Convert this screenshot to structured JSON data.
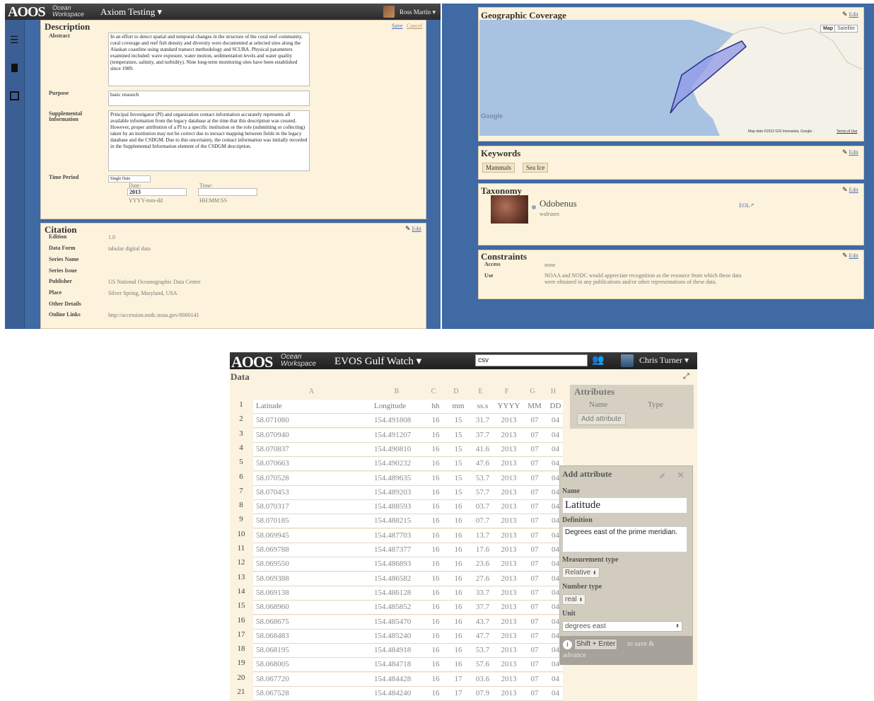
{
  "left_app": {
    "logo": "AOOS",
    "logo_sub1": "Ocean",
    "logo_sub2": "Workspace",
    "project": "Axiom Testing ▾",
    "user": "Ross Martin ▾",
    "description": {
      "title": "Description",
      "save": "Save",
      "cancel": "Cancel",
      "abstract_label": "Abstract",
      "abstract": "In an effort to detect spatial and temporal changes in the structure of the coral reef community, coral coverage and reef fish density and diversity were documented at selected sites along the Alaskan coastline using standard transect methodology and SCUBA. Physical parameters examined included: wave exposure, water motion, sedimentation levels and water quality (temperature, salinity, and turbidity). Nine long-term monitoring sites have been established since 1989.",
      "purpose_label": "Purpose",
      "purpose": "basic research",
      "supp_label1": "Supplemental",
      "supp_label2": "Information",
      "supplemental": "Principal Investigator (PI) and organization contact information accurately represents all available information from the legacy database at the time that this description was created. However, proper attribution of a PI to a specific institution or the role (submitting or collecting) taken by an institution may not be correct due to inexact mapping between fields in the legacy database and the CSDGM. Due to this uncertainty, the contact information was initially recorded in the Supplemental Information element of the CSDGM description.",
      "time_label": "Time Period",
      "time_select": "Single Date",
      "date_label": "Date:",
      "date_value": "2013",
      "date_hint": "YYYY-mm-dd",
      "time_field_label": "Time:",
      "time_hint": "HH:MM:SS"
    },
    "citation": {
      "title": "Citation",
      "edit": "Edit",
      "fields": [
        {
          "label": "Edition",
          "value": "1.0"
        },
        {
          "label": "Data Form",
          "value": "tabular digital data"
        },
        {
          "label": "Series Name",
          "value": ""
        },
        {
          "label": "Series Issue",
          "value": ""
        },
        {
          "label": "Publisher",
          "value": "US National Oceanographic Data Center"
        },
        {
          "label": "Place",
          "value": "Silver Spring, Maryland, USA"
        },
        {
          "label": "Other Details",
          "value": ""
        },
        {
          "label": "Online Links",
          "value": "http://accession.nodc.noaa.gov/0000141"
        }
      ]
    }
  },
  "right_app": {
    "geo": {
      "title": "Geographic Coverage",
      "edit": "Edit",
      "map_btn": "Map",
      "satellite_btn": "Satellite",
      "google": "Google",
      "attribution": "Map data ©2012 GIS Innovatsia, Google -",
      "terms": "Terms of Use"
    },
    "keywords": {
      "title": "Keywords",
      "edit": "Edit",
      "items": [
        "Mammals",
        "Sea Ice"
      ]
    },
    "taxonomy": {
      "title": "Taxonomy",
      "edit": "Edit",
      "name": "Odobenus",
      "common": "walruses",
      "eol": "EOL"
    },
    "constraints": {
      "title": "Constraints",
      "edit": "Edit",
      "access_label": "Access",
      "access": "none",
      "use_label": "Use",
      "use": "NOAA and NODC would appreciate recognition as the resource from which these data were obtained in any publications and/or other representations of these data."
    }
  },
  "bottom_app": {
    "logo": "AOOS",
    "logo_sub1": "Ocean",
    "logo_sub2": "Workspace",
    "project": "EVOS Gulf Watch ▾",
    "search_value": "csv",
    "user": "Chris Turner ▾",
    "data_title": "Data",
    "col_letters": [
      "A",
      "B",
      "C",
      "D",
      "E",
      "F",
      "G",
      "H"
    ],
    "headers": [
      "Latitude",
      "Longitude",
      "hh",
      "mm",
      "ss.s",
      "YYYY",
      "MM",
      "DD"
    ],
    "rows": [
      [
        "58.071080",
        "154.491808",
        "16",
        "15",
        "31.7",
        "2013",
        "07",
        "04"
      ],
      [
        "58.070940",
        "154.491207",
        "16",
        "15",
        "37.7",
        "2013",
        "07",
        "04"
      ],
      [
        "58.070837",
        "154.490810",
        "16",
        "15",
        "41.6",
        "2013",
        "07",
        "04"
      ],
      [
        "58.070663",
        "154.490232",
        "16",
        "15",
        "47.6",
        "2013",
        "07",
        "04"
      ],
      [
        "58.070528",
        "154.489635",
        "16",
        "15",
        "53.7",
        "2013",
        "07",
        "04"
      ],
      [
        "58.070453",
        "154.489203",
        "16",
        "15",
        "57.7",
        "2013",
        "07",
        "04"
      ],
      [
        "58.070317",
        "154.488593",
        "16",
        "16",
        "03.7",
        "2013",
        "07",
        "04"
      ],
      [
        "58.070185",
        "154.488215",
        "16",
        "16",
        "07.7",
        "2013",
        "07",
        "04"
      ],
      [
        "58.069945",
        "154.487703",
        "16",
        "16",
        "13.7",
        "2013",
        "07",
        "04"
      ],
      [
        "58.069788",
        "154.487377",
        "16",
        "16",
        "17.6",
        "2013",
        "07",
        "04"
      ],
      [
        "58.069550",
        "154.486893",
        "16",
        "16",
        "23.6",
        "2013",
        "07",
        "04"
      ],
      [
        "58.069388",
        "154.486582",
        "16",
        "16",
        "27.6",
        "2013",
        "07",
        "04"
      ],
      [
        "58.069138",
        "154.486128",
        "16",
        "16",
        "33.7",
        "2013",
        "07",
        "04"
      ],
      [
        "58.068960",
        "154.485852",
        "16",
        "16",
        "37.7",
        "2013",
        "07",
        "04"
      ],
      [
        "58.068675",
        "154.485470",
        "16",
        "16",
        "43.7",
        "2013",
        "07",
        "04"
      ],
      [
        "58.068483",
        "154.485240",
        "16",
        "16",
        "47.7",
        "2013",
        "07",
        "04"
      ],
      [
        "58.068195",
        "154.484918",
        "16",
        "16",
        "53.7",
        "2013",
        "07",
        "04"
      ],
      [
        "58.068005",
        "154.484718",
        "16",
        "16",
        "57.6",
        "2013",
        "07",
        "04"
      ],
      [
        "58.067720",
        "154.484428",
        "16",
        "17",
        "03.6",
        "2013",
        "07",
        "04"
      ],
      [
        "58.067528",
        "154.484240",
        "16",
        "17",
        "07.9",
        "2013",
        "07",
        "04"
      ]
    ],
    "attributes": {
      "title": "Attributes",
      "name_col": "Name",
      "type_col": "Type",
      "add_btn": "Add attribute"
    },
    "add_attribute": {
      "title": "Add attribute",
      "name_label": "Name",
      "name_value": "Latitude",
      "definition_label": "Definition",
      "definition_value": "Degrees east of the prime meridian.",
      "measurement_label": "Measurement type",
      "measurement_value": "Relative",
      "number_label": "Number type",
      "number_value": "real",
      "unit_label": "Unit",
      "unit_value": "degrees east",
      "hint_key": "Shift + Enter",
      "hint_text": "to save & advance"
    }
  }
}
